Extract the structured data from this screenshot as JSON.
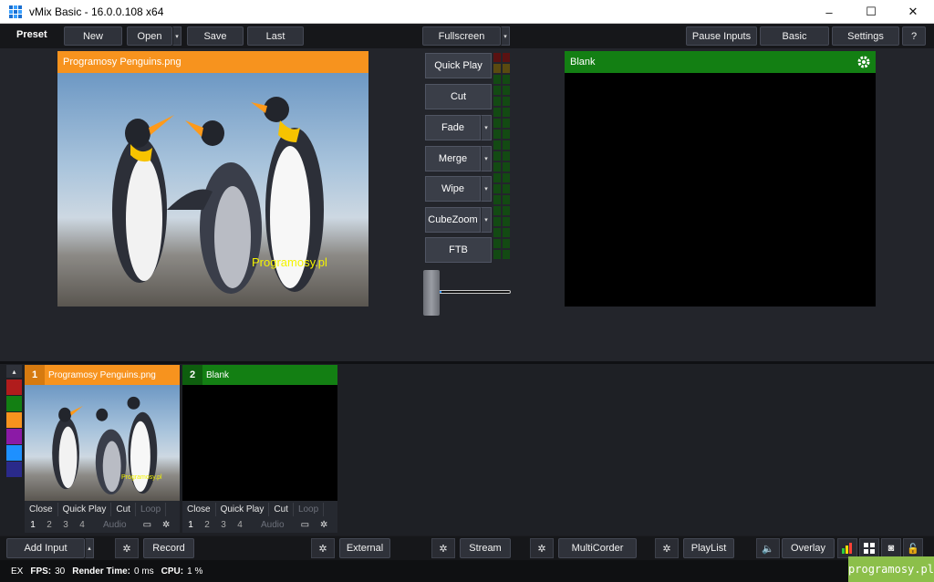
{
  "window": {
    "title": "vMix Basic - 16.0.0.108 x64",
    "controls": [
      "–",
      "☐",
      "✕"
    ]
  },
  "topbar": {
    "preset": "Preset",
    "new": "New",
    "open": "Open",
    "save": "Save",
    "last": "Last",
    "fullscreen": "Fullscreen",
    "pause_inputs": "Pause Inputs",
    "basic": "Basic",
    "settings": "Settings",
    "help": "?"
  },
  "preview": {
    "title": "Programosy Penguins.png",
    "watermark": "Programosy.pl"
  },
  "output": {
    "title": "Blank"
  },
  "transitions": [
    "Quick Play",
    "Cut",
    "Fade",
    "Merge",
    "Wipe",
    "CubeZoom",
    "FTB"
  ],
  "tbar": {
    "position": 0.2
  },
  "color_strip": [
    "#b01c1c",
    "#137f13",
    "#f7931e",
    "#8b1aa6",
    "#1e90ff",
    "#2a2a8a"
  ],
  "inputs": [
    {
      "number": "1",
      "title": "Programosy Penguins.png",
      "color": "#f7931e",
      "num_bg": "#d67a10",
      "watermark": "Programosy.pl",
      "actions": [
        "Close",
        "Quick Play",
        "Cut",
        "Loop"
      ],
      "slots": [
        "1",
        "2",
        "3",
        "4"
      ],
      "audio": "Audio"
    },
    {
      "number": "2",
      "title": "Blank",
      "color": "#137f13",
      "num_bg": "#0e5e0e",
      "actions": [
        "Close",
        "Quick Play",
        "Cut",
        "Loop"
      ],
      "slots": [
        "1",
        "2",
        "3",
        "4"
      ],
      "audio": "Audio"
    }
  ],
  "bottombar": {
    "add_input": "Add Input",
    "record": "Record",
    "external": "External",
    "stream": "Stream",
    "multicorder": "MultiCorder",
    "playlist": "PlayList",
    "overlay": "Overlay"
  },
  "status": {
    "ex": "EX",
    "fps_label": "FPS:",
    "fps": "30",
    "render_label": "Render Time:",
    "render": "0 ms",
    "cpu_label": "CPU:",
    "cpu": "1 %"
  },
  "brand": "programosy.pl"
}
